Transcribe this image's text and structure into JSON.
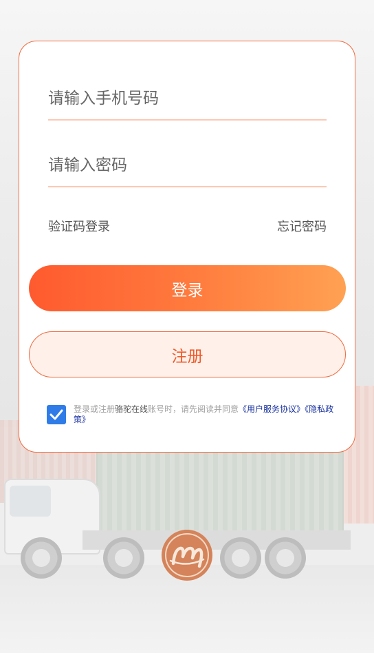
{
  "login_form": {
    "phone_placeholder": "请输入手机号码",
    "password_placeholder": "请输入密码",
    "sms_login_link": "验证码登录",
    "forgot_password_link": "忘记密码",
    "login_button": "登录",
    "register_button": "注册"
  },
  "agreement": {
    "checked": true,
    "prefix": "登录或注册",
    "app_name": "骆驼在线",
    "middle": "账号时，请先阅读并同意",
    "user_agreement": "《用户服务协议》",
    "privacy_policy": "《隐私政策》"
  },
  "colors": {
    "accent": "#f06a3e",
    "gradient_start": "#ff5a2f",
    "gradient_end": "#ffa152",
    "checkbox": "#2f7ce8",
    "link": "#1a33a0"
  },
  "icons": {
    "checkbox": "check-icon",
    "logo": "brand-logo-icon"
  }
}
